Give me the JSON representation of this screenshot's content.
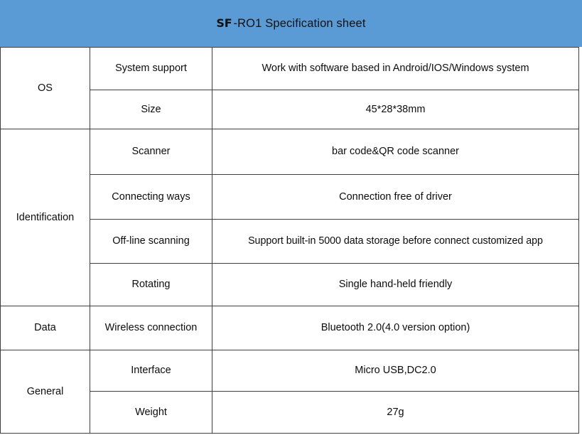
{
  "header": {
    "title_full": "SF-RO1 Specification sheet",
    "title_prefix": "SF",
    "title_rest": "-RO1 Specification sheet",
    "background_color": "#5B9BD5"
  },
  "table": {
    "border_color": "#3F3F3F",
    "background_color": "#FFFFFF",
    "columns": [
      "category",
      "attribute",
      "value"
    ],
    "groups": [
      {
        "category": "OS",
        "rows": [
          {
            "attribute": "System support",
            "value": "Work with software based in Android/IOS/Windows system"
          },
          {
            "attribute": "Size",
            "value": "45*28*38mm"
          }
        ]
      },
      {
        "category": "Identification",
        "rows": [
          {
            "attribute": "Scanner",
            "value": "bar code&QR code scanner"
          },
          {
            "attribute": "Connecting ways",
            "value": "Connection free of driver"
          },
          {
            "attribute": "Off-line scanning",
            "value": "Support built-in 5000 data storage before connect customized app"
          },
          {
            "attribute": "Rotating",
            "value": "Single hand-held friendly"
          }
        ]
      },
      {
        "category": "Data",
        "rows": [
          {
            "attribute": "Wireless connection",
            "value": "Bluetooth 2.0(4.0 version option)"
          }
        ]
      },
      {
        "category": "General",
        "rows": [
          {
            "attribute": "Interface",
            "value": "Micro USB,DC2.0"
          },
          {
            "attribute": "Weight",
            "value": "27g"
          }
        ]
      }
    ]
  }
}
